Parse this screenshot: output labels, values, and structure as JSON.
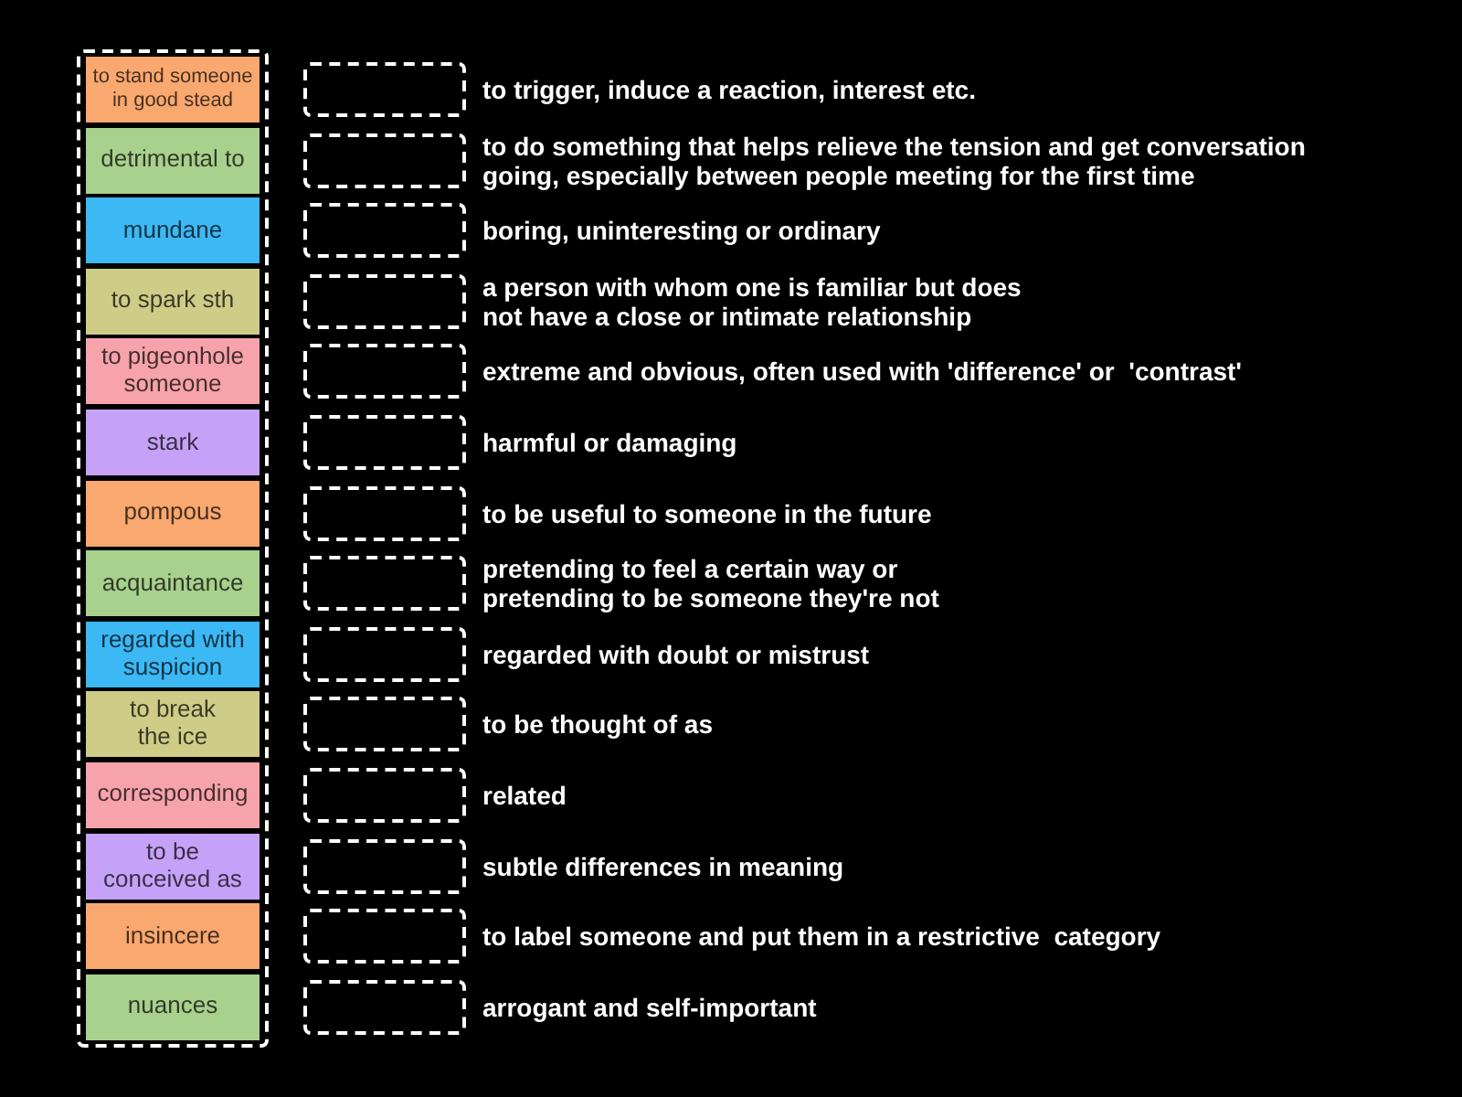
{
  "tiles": [
    {
      "text": "to stand someone\nin good stead",
      "color": "#f9a86f"
    },
    {
      "text": "detrimental to",
      "color": "#a8d18d"
    },
    {
      "text": "mundane",
      "color": "#3cb8f5"
    },
    {
      "text": "to spark sth",
      "color": "#cfcc88"
    },
    {
      "text": "to pigeonhole\nsomeone",
      "color": "#f7a3ab"
    },
    {
      "text": "stark",
      "color": "#c5a2f7"
    },
    {
      "text": "pompous",
      "color": "#f9a86f"
    },
    {
      "text": "acquaintance",
      "color": "#a8d18d"
    },
    {
      "text": "regarded with\nsuspicion",
      "color": "#3cb8f5"
    },
    {
      "text": "to break\nthe ice",
      "color": "#cfcc88"
    },
    {
      "text": "corresponding",
      "color": "#f7a3ab"
    },
    {
      "text": "to be\nconceived as",
      "color": "#c5a2f7"
    },
    {
      "text": "insincere",
      "color": "#f9a86f"
    },
    {
      "text": "nuances",
      "color": "#a8d18d"
    }
  ],
  "definitions": [
    "to trigger, induce a reaction, interest etc.",
    "to do something that helps relieve the tension and get conversation\ngoing, especially between people meeting for the first time",
    "boring, uninteresting or ordinary",
    "a person with whom one is familiar but does\nnot have a close or intimate relationship",
    "extreme and obvious, often used with 'difference' or  'contrast'",
    "harmful or damaging",
    "to be useful to someone in the future",
    "pretending to feel a certain way or\npretending to be someone they're not",
    "regarded with doubt or mistrust",
    "to be thought of as",
    "related",
    "subtle differences in meaning",
    "to label someone and put them in a restrictive  category",
    "arrogant and self-important"
  ]
}
